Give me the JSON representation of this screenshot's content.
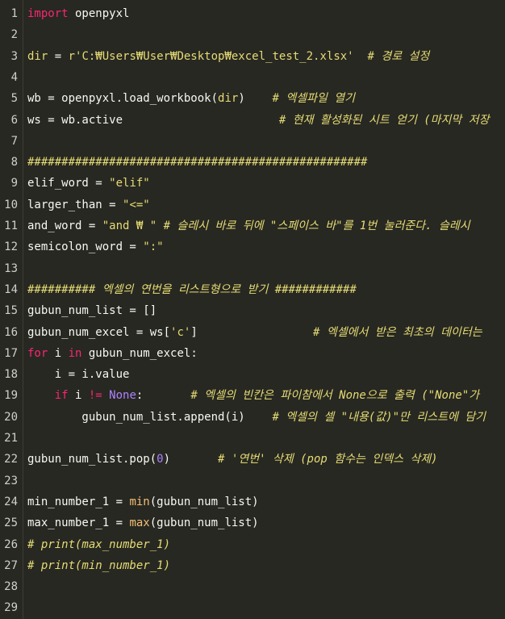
{
  "editor": {
    "lines": [
      {
        "n": "1",
        "segments": [
          {
            "t": "import",
            "c": "kw"
          },
          {
            "t": " openpyxl",
            "c": "plain"
          }
        ]
      },
      {
        "n": "2",
        "segments": []
      },
      {
        "n": "3",
        "segments": [
          {
            "t": "dir",
            "c": "bi"
          },
          {
            "t": " = ",
            "c": "plain"
          },
          {
            "t": "r'C:₩Users₩User₩Desktop₩excel_test_2.xlsx'",
            "c": "str"
          },
          {
            "t": "  # 경로 설정",
            "c": "cm"
          }
        ]
      },
      {
        "n": "4",
        "segments": []
      },
      {
        "n": "5",
        "segments": [
          {
            "t": "wb = openpyxl.load_workbook(",
            "c": "plain"
          },
          {
            "t": "dir",
            "c": "bi"
          },
          {
            "t": ")    ",
            "c": "plain"
          },
          {
            "t": "# 엑셀파일 열기",
            "c": "cm"
          }
        ]
      },
      {
        "n": "6",
        "segments": [
          {
            "t": "ws = wb.active                       ",
            "c": "plain"
          },
          {
            "t": "# 현재 활성화된 시트 얻기 (마지막 저장",
            "c": "cm"
          }
        ]
      },
      {
        "n": "7",
        "segments": []
      },
      {
        "n": "8",
        "segments": [
          {
            "t": "##################################################",
            "c": "cm"
          }
        ]
      },
      {
        "n": "9",
        "segments": [
          {
            "t": "elif_word = ",
            "c": "plain"
          },
          {
            "t": "\"elif\"",
            "c": "str"
          }
        ]
      },
      {
        "n": "10",
        "segments": [
          {
            "t": "larger_than = ",
            "c": "plain"
          },
          {
            "t": "\"<=\"",
            "c": "str"
          }
        ]
      },
      {
        "n": "11",
        "segments": [
          {
            "t": "and_word = ",
            "c": "plain"
          },
          {
            "t": "\"and ₩ \"",
            "c": "str"
          },
          {
            "t": " # 슬레시 바로 뒤에 \"스페이스 바\"를 1번 눌러준다. 슬레시",
            "c": "cm"
          }
        ]
      },
      {
        "n": "12",
        "segments": [
          {
            "t": "semicolon_word = ",
            "c": "plain"
          },
          {
            "t": "\":\"",
            "c": "str"
          }
        ]
      },
      {
        "n": "13",
        "segments": []
      },
      {
        "n": "14",
        "segments": [
          {
            "t": "########## 엑셀의 연번을 리스트형으로 받기 ############",
            "c": "cm"
          }
        ]
      },
      {
        "n": "15",
        "segments": [
          {
            "t": "gubun_num_list = []",
            "c": "plain"
          }
        ]
      },
      {
        "n": "16",
        "segments": [
          {
            "t": "gubun_num_excel = ws[",
            "c": "plain"
          },
          {
            "t": "'c'",
            "c": "str"
          },
          {
            "t": "]                 ",
            "c": "plain"
          },
          {
            "t": "# 엑셀에서 받은 최초의 데이터는",
            "c": "cm"
          }
        ]
      },
      {
        "n": "17",
        "segments": [
          {
            "t": "for",
            "c": "kw"
          },
          {
            "t": " i ",
            "c": "plain"
          },
          {
            "t": "in",
            "c": "kw"
          },
          {
            "t": " gubun_num_excel:",
            "c": "plain"
          }
        ]
      },
      {
        "n": "18",
        "segments": [
          {
            "t": "    i = i.value",
            "c": "plain"
          }
        ]
      },
      {
        "n": "19",
        "segments": [
          {
            "t": "    ",
            "c": "plain"
          },
          {
            "t": "if",
            "c": "kw"
          },
          {
            "t": " i ",
            "c": "plain"
          },
          {
            "t": "!=",
            "c": "kw"
          },
          {
            "t": " ",
            "c": "plain"
          },
          {
            "t": "None",
            "c": "num"
          },
          {
            "t": ":       ",
            "c": "plain"
          },
          {
            "t": "# 엑셀의 빈칸은 파이참에서 None으로 출력 (\"None\"가",
            "c": "cm"
          }
        ]
      },
      {
        "n": "20",
        "segments": [
          {
            "t": "        gubun_num_list.append(i)    ",
            "c": "plain"
          },
          {
            "t": "# 엑셀의 셀 \"내용(값)\"만 리스트에 담기",
            "c": "cm"
          }
        ]
      },
      {
        "n": "21",
        "segments": []
      },
      {
        "n": "22",
        "segments": [
          {
            "t": "gubun_num_list.pop(",
            "c": "plain"
          },
          {
            "t": "0",
            "c": "num"
          },
          {
            "t": ")       ",
            "c": "plain"
          },
          {
            "t": "# '연번' 삭제 (pop 함수는 인덱스 삭제)",
            "c": "cm"
          }
        ]
      },
      {
        "n": "23",
        "segments": []
      },
      {
        "n": "24",
        "segments": [
          {
            "t": "min_number_1 = ",
            "c": "plain"
          },
          {
            "t": "min",
            "c": "fn"
          },
          {
            "t": "(gubun_num_list)",
            "c": "plain"
          }
        ]
      },
      {
        "n": "25",
        "segments": [
          {
            "t": "max_number_1 = ",
            "c": "plain"
          },
          {
            "t": "max",
            "c": "fn"
          },
          {
            "t": "(gubun_num_list)",
            "c": "plain"
          }
        ]
      },
      {
        "n": "26",
        "segments": [
          {
            "t": "# print(max_number_1)",
            "c": "cm"
          }
        ]
      },
      {
        "n": "27",
        "segments": [
          {
            "t": "# print(min_number_1)",
            "c": "cm"
          }
        ]
      },
      {
        "n": "28",
        "segments": []
      },
      {
        "n": "29",
        "segments": []
      }
    ]
  }
}
